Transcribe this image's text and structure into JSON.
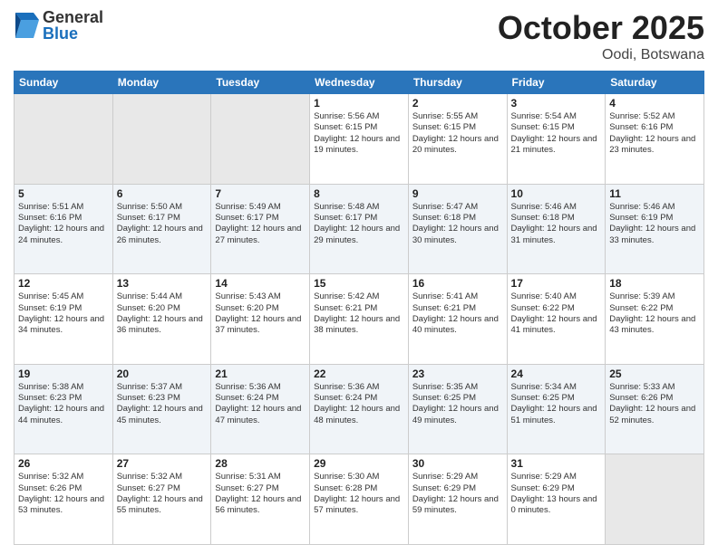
{
  "header": {
    "logo": {
      "line1": "General",
      "line2": "Blue"
    },
    "title": "October 2025",
    "location": "Oodi, Botswana"
  },
  "weekdays": [
    "Sunday",
    "Monday",
    "Tuesday",
    "Wednesday",
    "Thursday",
    "Friday",
    "Saturday"
  ],
  "weeks": [
    [
      {
        "day": "",
        "info": ""
      },
      {
        "day": "",
        "info": ""
      },
      {
        "day": "",
        "info": ""
      },
      {
        "day": "1",
        "info": "Sunrise: 5:56 AM\nSunset: 6:15 PM\nDaylight: 12 hours and 19 minutes."
      },
      {
        "day": "2",
        "info": "Sunrise: 5:55 AM\nSunset: 6:15 PM\nDaylight: 12 hours and 20 minutes."
      },
      {
        "day": "3",
        "info": "Sunrise: 5:54 AM\nSunset: 6:15 PM\nDaylight: 12 hours and 21 minutes."
      },
      {
        "day": "4",
        "info": "Sunrise: 5:52 AM\nSunset: 6:16 PM\nDaylight: 12 hours and 23 minutes."
      }
    ],
    [
      {
        "day": "5",
        "info": "Sunrise: 5:51 AM\nSunset: 6:16 PM\nDaylight: 12 hours and 24 minutes."
      },
      {
        "day": "6",
        "info": "Sunrise: 5:50 AM\nSunset: 6:17 PM\nDaylight: 12 hours and 26 minutes."
      },
      {
        "day": "7",
        "info": "Sunrise: 5:49 AM\nSunset: 6:17 PM\nDaylight: 12 hours and 27 minutes."
      },
      {
        "day": "8",
        "info": "Sunrise: 5:48 AM\nSunset: 6:17 PM\nDaylight: 12 hours and 29 minutes."
      },
      {
        "day": "9",
        "info": "Sunrise: 5:47 AM\nSunset: 6:18 PM\nDaylight: 12 hours and 30 minutes."
      },
      {
        "day": "10",
        "info": "Sunrise: 5:46 AM\nSunset: 6:18 PM\nDaylight: 12 hours and 31 minutes."
      },
      {
        "day": "11",
        "info": "Sunrise: 5:46 AM\nSunset: 6:19 PM\nDaylight: 12 hours and 33 minutes."
      }
    ],
    [
      {
        "day": "12",
        "info": "Sunrise: 5:45 AM\nSunset: 6:19 PM\nDaylight: 12 hours and 34 minutes."
      },
      {
        "day": "13",
        "info": "Sunrise: 5:44 AM\nSunset: 6:20 PM\nDaylight: 12 hours and 36 minutes."
      },
      {
        "day": "14",
        "info": "Sunrise: 5:43 AM\nSunset: 6:20 PM\nDaylight: 12 hours and 37 minutes."
      },
      {
        "day": "15",
        "info": "Sunrise: 5:42 AM\nSunset: 6:21 PM\nDaylight: 12 hours and 38 minutes."
      },
      {
        "day": "16",
        "info": "Sunrise: 5:41 AM\nSunset: 6:21 PM\nDaylight: 12 hours and 40 minutes."
      },
      {
        "day": "17",
        "info": "Sunrise: 5:40 AM\nSunset: 6:22 PM\nDaylight: 12 hours and 41 minutes."
      },
      {
        "day": "18",
        "info": "Sunrise: 5:39 AM\nSunset: 6:22 PM\nDaylight: 12 hours and 43 minutes."
      }
    ],
    [
      {
        "day": "19",
        "info": "Sunrise: 5:38 AM\nSunset: 6:23 PM\nDaylight: 12 hours and 44 minutes."
      },
      {
        "day": "20",
        "info": "Sunrise: 5:37 AM\nSunset: 6:23 PM\nDaylight: 12 hours and 45 minutes."
      },
      {
        "day": "21",
        "info": "Sunrise: 5:36 AM\nSunset: 6:24 PM\nDaylight: 12 hours and 47 minutes."
      },
      {
        "day": "22",
        "info": "Sunrise: 5:36 AM\nSunset: 6:24 PM\nDaylight: 12 hours and 48 minutes."
      },
      {
        "day": "23",
        "info": "Sunrise: 5:35 AM\nSunset: 6:25 PM\nDaylight: 12 hours and 49 minutes."
      },
      {
        "day": "24",
        "info": "Sunrise: 5:34 AM\nSunset: 6:25 PM\nDaylight: 12 hours and 51 minutes."
      },
      {
        "day": "25",
        "info": "Sunrise: 5:33 AM\nSunset: 6:26 PM\nDaylight: 12 hours and 52 minutes."
      }
    ],
    [
      {
        "day": "26",
        "info": "Sunrise: 5:32 AM\nSunset: 6:26 PM\nDaylight: 12 hours and 53 minutes."
      },
      {
        "day": "27",
        "info": "Sunrise: 5:32 AM\nSunset: 6:27 PM\nDaylight: 12 hours and 55 minutes."
      },
      {
        "day": "28",
        "info": "Sunrise: 5:31 AM\nSunset: 6:27 PM\nDaylight: 12 hours and 56 minutes."
      },
      {
        "day": "29",
        "info": "Sunrise: 5:30 AM\nSunset: 6:28 PM\nDaylight: 12 hours and 57 minutes."
      },
      {
        "day": "30",
        "info": "Sunrise: 5:29 AM\nSunset: 6:29 PM\nDaylight: 12 hours and 59 minutes."
      },
      {
        "day": "31",
        "info": "Sunrise: 5:29 AM\nSunset: 6:29 PM\nDaylight: 13 hours and 0 minutes."
      },
      {
        "day": "",
        "info": ""
      }
    ]
  ]
}
